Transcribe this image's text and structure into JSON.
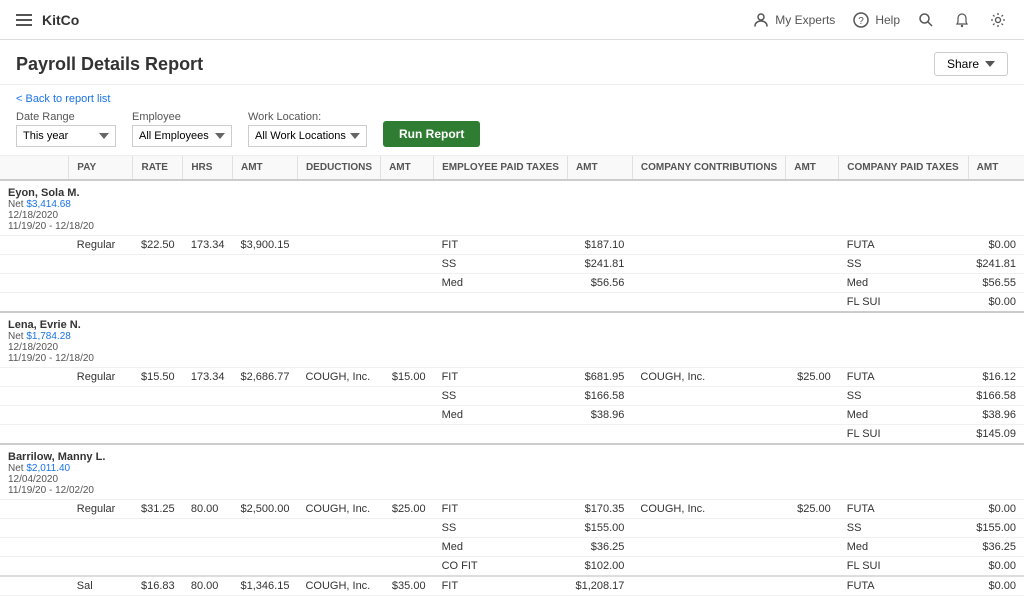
{
  "nav": {
    "brand": "KitCo",
    "my_experts": "My Experts",
    "help": "Help"
  },
  "page": {
    "title": "Payroll Details Report",
    "back_link": "< Back to report list",
    "share_label": "Share"
  },
  "filters": {
    "date_range_label": "Date Range",
    "date_range_value": "This year",
    "employee_label": "Employee",
    "employee_value": "All Employees",
    "work_location_label": "Work Location:",
    "work_location_value": "All Work Locations",
    "run_report_label": "Run Report"
  },
  "table": {
    "headers": {
      "pay": "PAY",
      "rate": "RATE",
      "hrs": "HRS",
      "amt": "AMT",
      "deductions": "DEDUCTIONS",
      "damt": "AMT",
      "employee_paid_taxes": "EMPLOYEE PAID TAXES",
      "etamt": "AMT",
      "company_contributions": "COMPANY CONTRIBUTIONS",
      "camt": "AMT",
      "company_paid_taxes": "COMPANY PAID TAXES",
      "txamt": "AMT"
    },
    "employees": [
      {
        "name": "Eyon, Sola M.",
        "net_label": "Net",
        "net_amount": "$3,414.68",
        "date1": "12/18/2020",
        "date2": "11/19/20 - 12/18/20",
        "rows": [
          {
            "pay": "Regular",
            "rate": "$22.50",
            "hrs": "173.34",
            "amt": "$3,900.15",
            "deductions": "",
            "damt": "",
            "emp_tax": "FIT",
            "etamt": "$187.10",
            "contrib": "",
            "camt": "",
            "comp_tax": "FUTA",
            "txamt": "$0.00"
          },
          {
            "pay": "",
            "rate": "",
            "hrs": "",
            "amt": "",
            "deductions": "",
            "damt": "",
            "emp_tax": "SS",
            "etamt": "$241.81",
            "contrib": "",
            "camt": "",
            "comp_tax": "SS",
            "txamt": "$241.81"
          },
          {
            "pay": "",
            "rate": "",
            "hrs": "",
            "amt": "",
            "deductions": "",
            "damt": "",
            "emp_tax": "Med",
            "etamt": "$56.56",
            "contrib": "",
            "camt": "",
            "comp_tax": "Med",
            "txamt": "$56.55"
          },
          {
            "pay": "",
            "rate": "",
            "hrs": "",
            "amt": "",
            "deductions": "",
            "damt": "",
            "emp_tax": "",
            "etamt": "",
            "contrib": "",
            "camt": "",
            "comp_tax": "FL SUI",
            "txamt": "$0.00"
          }
        ]
      },
      {
        "name": "Lena, Evrie N.",
        "net_label": "Net",
        "net_amount": "$1,784.28",
        "date1": "12/18/2020",
        "date2": "11/19/20 - 12/18/20",
        "rows": [
          {
            "pay": "Regular",
            "rate": "$15.50",
            "hrs": "173.34",
            "amt": "$2,686.77",
            "deductions": "COUGH, Inc.",
            "damt": "$15.00",
            "emp_tax": "FIT",
            "etamt": "$681.95",
            "contrib": "COUGH, Inc.",
            "camt": "$25.00",
            "comp_tax": "FUTA",
            "txamt": "$16.12"
          },
          {
            "pay": "",
            "rate": "",
            "hrs": "",
            "amt": "",
            "deductions": "",
            "damt": "",
            "emp_tax": "SS",
            "etamt": "$166.58",
            "contrib": "",
            "camt": "",
            "comp_tax": "SS",
            "txamt": "$166.58"
          },
          {
            "pay": "",
            "rate": "",
            "hrs": "",
            "amt": "",
            "deductions": "",
            "damt": "",
            "emp_tax": "Med",
            "etamt": "$38.96",
            "contrib": "",
            "camt": "",
            "comp_tax": "Med",
            "txamt": "$38.96"
          },
          {
            "pay": "",
            "rate": "",
            "hrs": "",
            "amt": "",
            "deductions": "",
            "damt": "",
            "emp_tax": "",
            "etamt": "",
            "contrib": "",
            "camt": "",
            "comp_tax": "FL SUI",
            "txamt": "$145.09"
          }
        ]
      },
      {
        "name": "Barrilow, Manny L.",
        "net_label": "Net",
        "net_amount": "$2,011.40",
        "date1": "12/04/2020",
        "date2": "11/19/20 - 12/02/20",
        "rows": [
          {
            "pay": "Regular",
            "rate": "$31.25",
            "hrs": "80.00",
            "amt": "$2,500.00",
            "deductions": "COUGH, Inc.",
            "damt": "$25.00",
            "emp_tax": "FIT",
            "etamt": "$170.35",
            "contrib": "COUGH, Inc.",
            "camt": "$25.00",
            "comp_tax": "FUTA",
            "txamt": "$0.00"
          },
          {
            "pay": "",
            "rate": "",
            "hrs": "",
            "amt": "",
            "deductions": "",
            "damt": "",
            "emp_tax": "SS",
            "etamt": "$155.00",
            "contrib": "",
            "camt": "",
            "comp_tax": "SS",
            "txamt": "$155.00"
          },
          {
            "pay": "",
            "rate": "",
            "hrs": "",
            "amt": "",
            "deductions": "",
            "damt": "",
            "emp_tax": "Med",
            "etamt": "$36.25",
            "contrib": "",
            "camt": "",
            "comp_tax": "Med",
            "txamt": "$36.25"
          },
          {
            "pay": "",
            "rate": "",
            "hrs": "",
            "amt": "",
            "deductions": "",
            "damt": "",
            "emp_tax": "CO FIT",
            "etamt": "$102.00",
            "contrib": "",
            "camt": "",
            "comp_tax": "FL SUI",
            "txamt": "$0.00"
          }
        ]
      },
      {
        "name": "",
        "net_label": "",
        "net_amount": "",
        "date1": "",
        "date2": "",
        "rows": [
          {
            "pay": "Sal",
            "rate": "$16.83",
            "hrs": "80.00",
            "amt": "$1,346.15",
            "deductions": "COUGH, Inc.",
            "damt": "$35.00",
            "emp_tax": "FIT",
            "etamt": "$1,208.17",
            "contrib": "",
            "camt": "",
            "comp_tax": "FUTA",
            "txamt": "$0.00"
          }
        ]
      }
    ]
  }
}
